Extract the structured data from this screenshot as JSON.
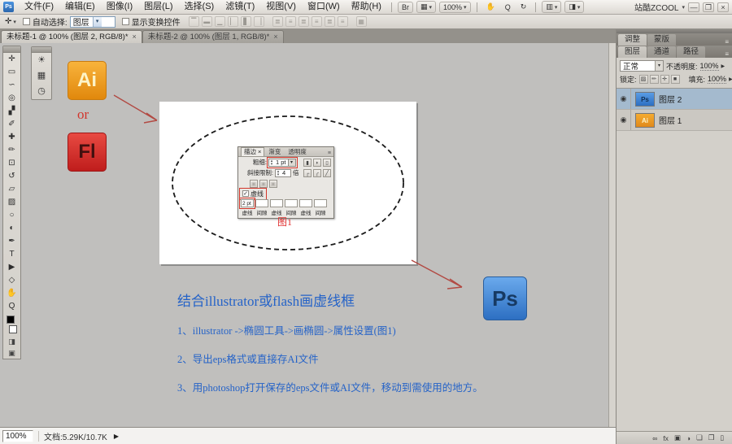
{
  "window": {
    "workspace": "站酷ZCOOL",
    "minimize": "—",
    "restore": "❐",
    "close": "×"
  },
  "menu_bar": {
    "items": [
      "文件(F)",
      "编辑(E)",
      "图像(I)",
      "图层(L)",
      "选择(S)",
      "滤镜(T)",
      "视图(V)",
      "窗口(W)",
      "帮助(H)"
    ]
  },
  "app_bar": {
    "zoom_level": "100%"
  },
  "icons": {
    "bridge": "Br",
    "view_extras": "▦",
    "hand": "✋",
    "zoom_tool": "Q",
    "rotate": "↻",
    "arrange": "▥",
    "screen_mode": "◨",
    "dropdown": "▾",
    "menu_btn": "≡",
    "eye": "◉",
    "move": "✛",
    "check": "✓",
    "flyout": "▶",
    "auto_align": "▦"
  },
  "options_bar": {
    "auto_select_label": "自动选择:",
    "auto_select_value": "图层",
    "show_transform_label": "显示变换控件",
    "align_icons": [
      {
        "name": "align-top-icon",
        "glyph": "▔"
      },
      {
        "name": "align-vertical-center-icon",
        "glyph": "▬"
      },
      {
        "name": "align-bottom-icon",
        "glyph": "▁"
      },
      {
        "name": "align-left-icon",
        "glyph": "▏"
      },
      {
        "name": "align-horizontal-center-icon",
        "glyph": "▋"
      },
      {
        "name": "align-right-icon",
        "glyph": "▕"
      }
    ],
    "distribute_icons": [
      {
        "name": "distribute-top-icon",
        "glyph": "≣"
      },
      {
        "name": "distribute-vertical-center-icon",
        "glyph": "≡"
      },
      {
        "name": "distribute-bottom-icon",
        "glyph": "≣"
      },
      {
        "name": "distribute-left-icon",
        "glyph": "≡"
      },
      {
        "name": "distribute-horizontal-center-icon",
        "glyph": "≣"
      },
      {
        "name": "distribute-right-icon",
        "glyph": "≡"
      }
    ]
  },
  "tabs": [
    {
      "title": "未标题-1 @ 100% (图层 2, RGB/8)*",
      "close": "×"
    },
    {
      "title": "未标题-2 @ 100% (图层 1, RGB/8)*",
      "close": "×"
    }
  ],
  "toolbox": {
    "tools": [
      {
        "name": "move-tool",
        "glyph": "✛"
      },
      {
        "name": "rectangular-marquee-tool",
        "glyph": "▭"
      },
      {
        "name": "lasso-tool",
        "glyph": "∽"
      },
      {
        "name": "quick-selection-tool",
        "glyph": "◎"
      },
      {
        "name": "crop-tool",
        "glyph": "▞"
      },
      {
        "name": "eyedropper-tool",
        "glyph": "✐"
      },
      {
        "name": "spot-healing-brush-tool",
        "glyph": "✚"
      },
      {
        "name": "brush-tool",
        "glyph": "✏"
      },
      {
        "name": "clone-stamp-tool",
        "glyph": "⊡"
      },
      {
        "name": "history-brush-tool",
        "glyph": "↺"
      },
      {
        "name": "eraser-tool",
        "glyph": "▱"
      },
      {
        "name": "gradient-tool",
        "glyph": "▨"
      },
      {
        "name": "blur-tool",
        "glyph": "○"
      },
      {
        "name": "dodge-tool",
        "glyph": "◐"
      },
      {
        "name": "pen-tool",
        "glyph": "✒"
      },
      {
        "name": "type-tool",
        "glyph": "T"
      },
      {
        "name": "path-selection-tool",
        "glyph": "▶"
      },
      {
        "name": "shape-tool",
        "glyph": "◇"
      },
      {
        "name": "hand-tool",
        "glyph": "✋"
      },
      {
        "name": "zoom-tool",
        "glyph": "Q"
      }
    ]
  },
  "mini_panel": {
    "icons": [
      {
        "name": "adjust-light-icon",
        "glyph": "☀"
      },
      {
        "name": "photo-icon",
        "glyph": "▦"
      },
      {
        "name": "clock-icon",
        "glyph": "◷"
      }
    ]
  },
  "canvas": {
    "ai_badge": "Ai",
    "or_label": "or",
    "fl_badge": "Fl",
    "ps_badge": "Ps",
    "figure_label": "图1",
    "stroke_panel": {
      "tabs": [
        "描边",
        "渐变",
        "透明度"
      ],
      "tab_close": "×",
      "weight_label": "粗细:",
      "weight_value": "1 pt",
      "miter_label": "斜接限制:",
      "miter_value": "4",
      "miter_unit": "倍",
      "dash_label": "虚线",
      "dash_value": "2 pt",
      "dash_field_labels": [
        "虚线",
        "间隙",
        "虚线",
        "间隙",
        "虚线",
        "间隙"
      ],
      "cap_icons": [
        {
          "name": "cap-butt-icon",
          "glyph": "▮"
        },
        {
          "name": "cap-round-icon",
          "glyph": "◗"
        },
        {
          "name": "cap-projecting-icon",
          "glyph": "▯"
        }
      ],
      "join_icons": [
        {
          "name": "join-miter-icon",
          "glyph": "┌"
        },
        {
          "name": "join-round-icon",
          "glyph": "╭"
        },
        {
          "name": "join-bevel-icon",
          "glyph": "╱"
        }
      ],
      "align_stroke_icons": [
        {
          "name": "stroke-align-center-icon",
          "glyph": "▣"
        },
        {
          "name": "stroke-align-inside-icon",
          "glyph": "▣"
        },
        {
          "name": "stroke-align-outside-icon",
          "glyph": "▣"
        }
      ]
    },
    "notes": {
      "title": "结合illustrator或flash画虚线框",
      "items": [
        "1、illustrator ->椭圆工具->画椭圆->属性设置(图1)",
        "2、导出eps格式或直接存AI文件",
        "3、用photoshop打开保存的eps文件或AI文件，移动到需使用的地方。"
      ]
    }
  },
  "right_dock": {
    "group1_tabs": [
      "调整",
      "蒙版"
    ],
    "group2_tabs": [
      "图层",
      "通道",
      "路径"
    ],
    "blend_mode": "正常",
    "opacity_label": "不透明度:",
    "opacity_value": "100%",
    "lock_label": "锁定:",
    "lock_icons": [
      {
        "name": "lock-transparency-icon",
        "glyph": "▨"
      },
      {
        "name": "lock-image-icon",
        "glyph": "✏"
      },
      {
        "name": "lock-position-icon",
        "glyph": "✛"
      },
      {
        "name": "lock-all-icon",
        "glyph": "■"
      }
    ],
    "fill_label": "填充:",
    "fill_value": "100%",
    "layers": [
      {
        "name": "图层 2",
        "badge": "Ps"
      },
      {
        "name": "图层 1",
        "badge": "Ai"
      }
    ],
    "bottom_icons": [
      {
        "name": "link-layers-icon",
        "glyph": "∞"
      },
      {
        "name": "layer-style-icon",
        "glyph": "fx"
      },
      {
        "name": "add-layer-mask-icon",
        "glyph": "▣"
      },
      {
        "name": "adjustment-layer-icon",
        "glyph": "◑"
      },
      {
        "name": "new-group-icon",
        "glyph": "❏"
      },
      {
        "name": "new-layer-icon",
        "glyph": "❐"
      },
      {
        "name": "delete-layer-icon",
        "glyph": "▯"
      }
    ]
  },
  "status_bar": {
    "zoom": "100%",
    "doc_info": "文档:5.29K/10.7K"
  },
  "colors": {
    "blue_text": "#2563c8",
    "highlight_red": "#d3362b",
    "arrow_red": "#b24a43",
    "ai_orange": "#ef9c21",
    "fl_red": "#cf2b28",
    "ps_blue": "#3f86d6",
    "layer_selected": "#a4bace",
    "canvas_bg": "#c0bfbd"
  }
}
